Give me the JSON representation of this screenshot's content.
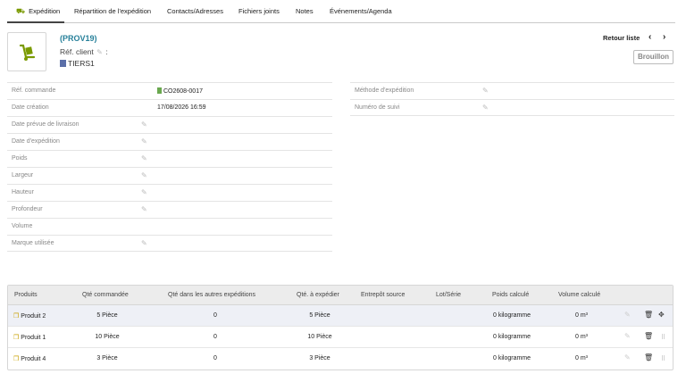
{
  "tabs": [
    {
      "label": "Expédition",
      "active": true
    },
    {
      "label": "Répartition de l'expédition"
    },
    {
      "label": "Contacts/Adresses"
    },
    {
      "label": "Fichiers joints"
    },
    {
      "label": "Notes"
    },
    {
      "label": "Événements/Agenda"
    }
  ],
  "header": {
    "ref": "(PROV19)",
    "ref_client_label": "Réf. client",
    "ref_client_suffix": ":",
    "tiers": "TIERS1",
    "back_label": "Retour liste",
    "prev": "‹",
    "next": "›",
    "status": "Brouillon"
  },
  "fields_left": [
    {
      "label": "Réf. commande",
      "value": "CO2608-0017",
      "editable": false,
      "link": true
    },
    {
      "label": "Date création",
      "value": "17/08/2026 16:59",
      "editable": false
    },
    {
      "label": "Date prévue de livraison",
      "value": "",
      "editable": true
    },
    {
      "label": "Date d'expédition",
      "value": "",
      "editable": true
    },
    {
      "label": "Poids",
      "value": "",
      "editable": true
    },
    {
      "label": "Largeur",
      "value": "",
      "editable": true
    },
    {
      "label": "Hauteur",
      "value": "",
      "editable": true
    },
    {
      "label": "Profondeur",
      "value": "",
      "editable": true
    },
    {
      "label": "Volume",
      "value": "",
      "editable": false
    },
    {
      "label": "Marque utilisée",
      "value": "",
      "editable": true
    }
  ],
  "fields_right": [
    {
      "label": "Méthode d'expédition",
      "editable": true
    },
    {
      "label": "Numéro de suivi",
      "editable": true
    }
  ],
  "table": {
    "headers": [
      "Produits",
      "Qté commandée",
      "Qté dans les autres expéditions",
      "Qté. à expédier",
      "Entrepôt source",
      "Lot/Série",
      "Poids calculé",
      "Volume calculé"
    ],
    "rows": [
      {
        "product": "Produit 2",
        "qty_ordered": "5 Pièce",
        "qty_other": "0",
        "qty_ship": "5 Pièce",
        "weight": "0 kilogramme",
        "volume": "0 m³"
      },
      {
        "product": "Produit 1",
        "qty_ordered": "10 Pièce",
        "qty_other": "0",
        "qty_ship": "10 Pièce",
        "weight": "0 kilogramme",
        "volume": "0 m³"
      },
      {
        "product": "Produit 4",
        "qty_ordered": "3 Pièce",
        "qty_other": "0",
        "qty_ship": "3 Pièce",
        "weight": "0 kilogramme",
        "volume": "0 m³"
      }
    ]
  },
  "colors": {
    "accent": "#27809a",
    "tab_icon": "#7a9a00",
    "highlight_row": "#eef0f6"
  },
  "icons": {
    "tab": "dolly-icon",
    "logo": "dolly-icon",
    "tiers": "building-icon",
    "product": "box-icon",
    "edit": "pencil-icon",
    "delete": "trash-icon",
    "move": "move-icon"
  }
}
